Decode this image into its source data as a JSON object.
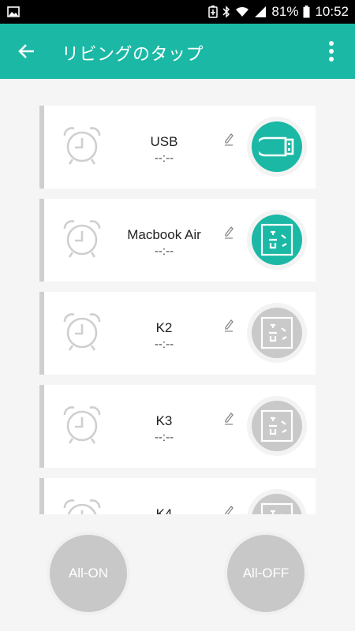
{
  "status_bar": {
    "battery": "81%",
    "time": "10:52"
  },
  "app_bar": {
    "title": "リビングのタップ"
  },
  "colors": {
    "accent": "#1bb9a5",
    "off": "#c9c9c9"
  },
  "outlets": [
    {
      "name": "USB",
      "timer": "--:--",
      "icon": "usb-icon",
      "state": "on"
    },
    {
      "name": "Macbook Air",
      "timer": "--:--",
      "icon": "outlet-icon",
      "state": "on"
    },
    {
      "name": "K2",
      "timer": "--:--",
      "icon": "outlet-icon",
      "state": "off"
    },
    {
      "name": "K3",
      "timer": "--:--",
      "icon": "outlet-icon",
      "state": "off"
    },
    {
      "name": "K4",
      "timer": "--:--",
      "icon": "outlet-icon",
      "state": "off"
    }
  ],
  "bottom": {
    "all_on": "All-ON",
    "all_off": "All-OFF"
  }
}
